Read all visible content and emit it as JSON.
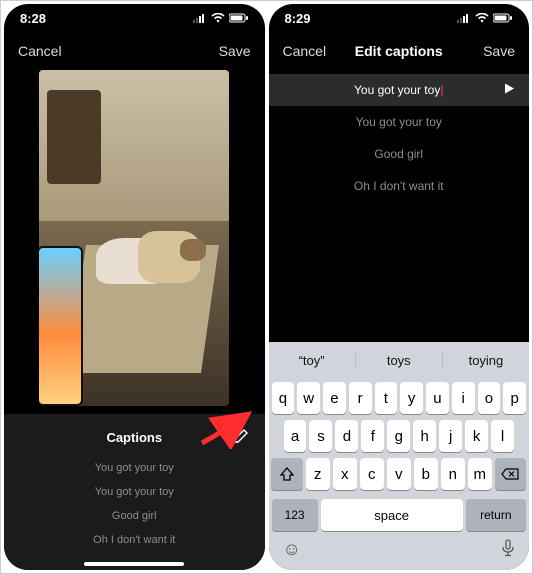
{
  "left": {
    "time": "8:28",
    "cancel": "Cancel",
    "save": "Save",
    "captions_title": "Captions",
    "captions": [
      "You got your toy",
      "You got your toy",
      "Good girl",
      "Oh I don't want it"
    ]
  },
  "right": {
    "time": "8:29",
    "cancel": "Cancel",
    "title": "Edit captions",
    "save": "Save",
    "captions": [
      "You got your toy",
      "You got your toy",
      "Good girl",
      "Oh I don't want it"
    ],
    "selected_index": 0,
    "suggestions": [
      "“toy”",
      "toys",
      "toying"
    ],
    "keyboard": {
      "row1": [
        "q",
        "w",
        "e",
        "r",
        "t",
        "y",
        "u",
        "i",
        "o",
        "p"
      ],
      "row2": [
        "a",
        "s",
        "d",
        "f",
        "g",
        "h",
        "j",
        "k",
        "l"
      ],
      "row3": [
        "z",
        "x",
        "c",
        "v",
        "b",
        "n",
        "m"
      ],
      "num": "123",
      "space": "space",
      "ret": "return"
    }
  }
}
